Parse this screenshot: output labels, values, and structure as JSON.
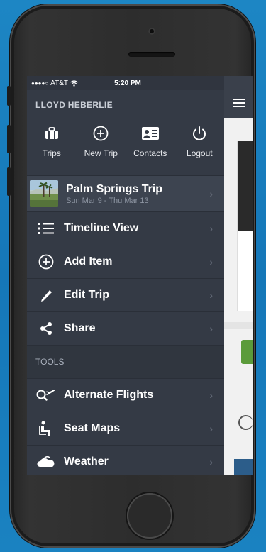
{
  "status": {
    "carrier": "AT&T",
    "time": "5:20 PM"
  },
  "user": {
    "name": "LLOYD HEBERLIE"
  },
  "actions": [
    {
      "label": "Trips",
      "icon": "briefcase-icon"
    },
    {
      "label": "New Trip",
      "icon": "plus-circle-icon"
    },
    {
      "label": "Contacts",
      "icon": "contact-card-icon"
    },
    {
      "label": "Logout",
      "icon": "power-icon"
    }
  ],
  "trip": {
    "title": "Palm Springs Trip",
    "dates": "Sun Mar 9 - Thu Mar 13"
  },
  "menu": [
    {
      "label": "Timeline View",
      "icon": "list-icon"
    },
    {
      "label": "Add Item",
      "icon": "plus-circle-icon"
    },
    {
      "label": "Edit Trip",
      "icon": "pencil-icon"
    },
    {
      "label": "Share",
      "icon": "share-icon"
    }
  ],
  "tools": {
    "heading": "TOOLS",
    "items": [
      {
        "label": "Alternate Flights",
        "icon": "search-plane-icon"
      },
      {
        "label": "Seat Maps",
        "icon": "seat-icon"
      },
      {
        "label": "Weather",
        "icon": "cloud-icon"
      }
    ]
  },
  "colors": {
    "menu_bg": "#343a45",
    "background": "#1a80c0"
  }
}
